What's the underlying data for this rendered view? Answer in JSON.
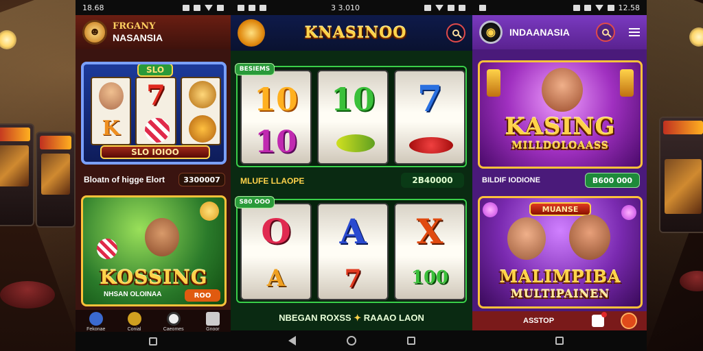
{
  "left": {
    "time": "18.68",
    "brand_line1": "FRGANY",
    "brand_line2": "NASANSIA",
    "banner_badge": "SLO",
    "banner_plate": "SLO IOIOO",
    "symbols": [
      "7",
      "K"
    ],
    "row_label": "Bloatn of higge Elort",
    "row_value": "3300007",
    "promo_title": "KOSSING",
    "promo_subtitle": "NHSAN OLOINAA",
    "promo_button": "ROO",
    "tabs": [
      "Fekonae",
      "Conial",
      "Caeomes",
      "Gnoor"
    ]
  },
  "middle": {
    "time": "3 3.010",
    "title": "KNASINOO",
    "reel_badge_top": "BESIEMS",
    "reel_badge_bottom": "S80 OOO",
    "reel_symbols_top": [
      "10",
      "10",
      "7",
      "10"
    ],
    "reel_symbols_bottom": [
      "O",
      "A",
      "X",
      "A",
      "7",
      "100"
    ],
    "row_label": "MLUFE LLAOPE",
    "row_value": "2B40000",
    "footer_text": "NBEGAN ROXSS",
    "footer_text2": "RAAAO LAON"
  },
  "right": {
    "time": "12.58",
    "title": "INDAANASIA",
    "banner_title": "KASING",
    "banner_subtitle": "MILLDOLOAASS",
    "row_label": "BILDIF IODIONE",
    "row_value": "B600 000",
    "promo_tag": "MUANSE",
    "promo_title": "MALIMPIBA",
    "promo_subtitle": "MULTIPAINEN",
    "footer_label": "ASSTOP"
  },
  "colors": {
    "left_header": "#5a1a10",
    "middle_header": "#0e1a4a",
    "right_header": "#6a2aa8",
    "accent_green": "#2ea84a",
    "accent_gold": "#ffd34a"
  }
}
